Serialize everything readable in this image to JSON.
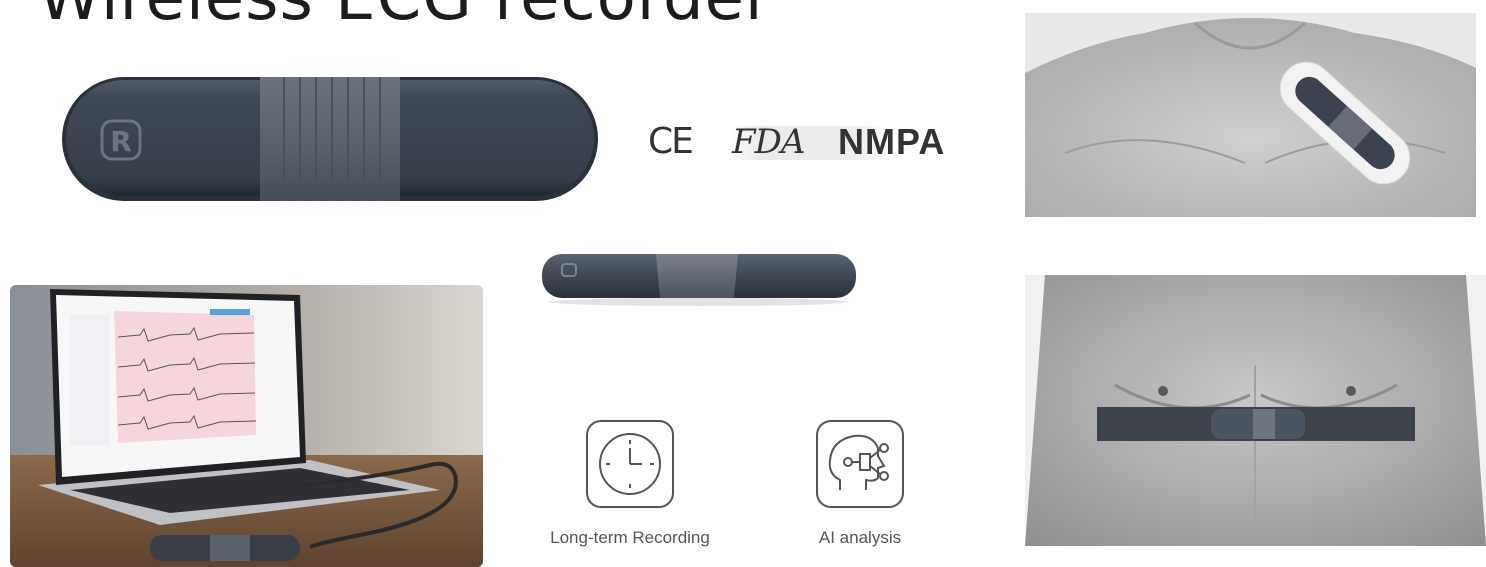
{
  "title": "Wireless ECG recorder",
  "device": {
    "logo_letter": "R"
  },
  "certifications": {
    "ce": "CE",
    "fda": "FDA",
    "nmpa": "NMPA"
  },
  "features": [
    {
      "label": "Long-term Recording",
      "icon": "clock-icon"
    },
    {
      "label": "AI analysis",
      "icon": "ai-head-icon"
    }
  ],
  "colors": {
    "device_body": "#3d4654",
    "device_band": "#5c6470",
    "text_dark": "#1c1c1c"
  }
}
